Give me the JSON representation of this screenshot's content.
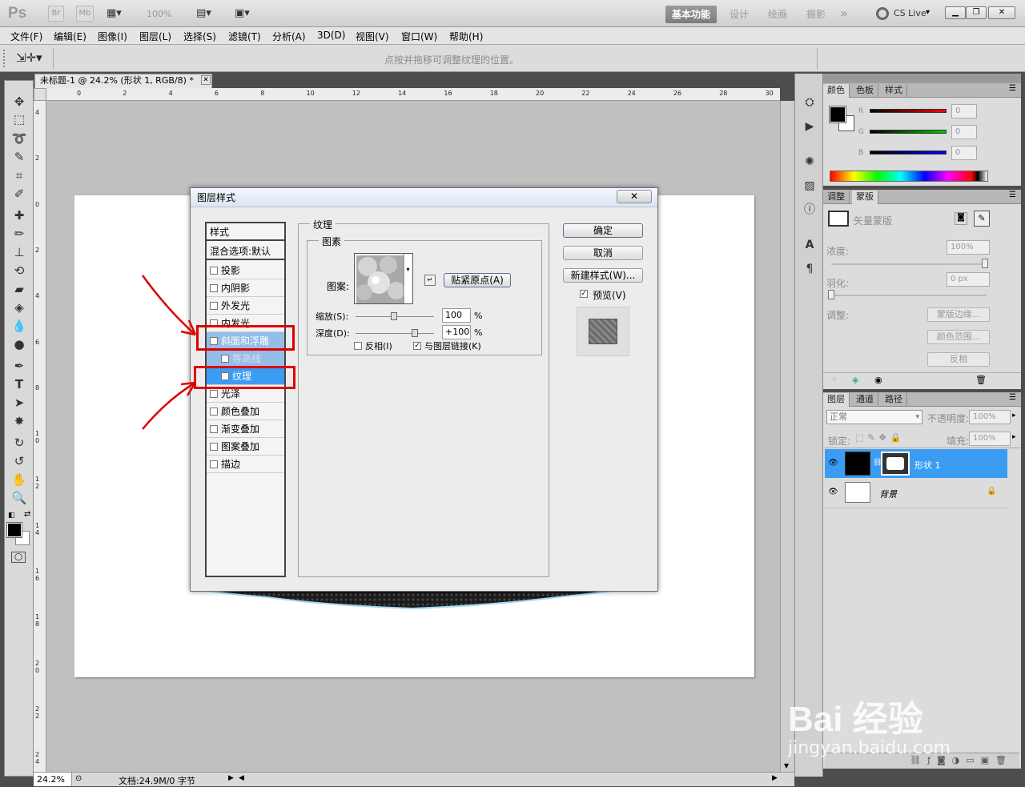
{
  "titlebar": {
    "app_logo": "Ps",
    "br": "Br",
    "mb": "Mb",
    "zoom": "100%",
    "workspaces": [
      "基本功能",
      "设计",
      "绘画",
      "摄影"
    ],
    "more": "»",
    "cslive": "CS Live"
  },
  "menubar": [
    "文件(F)",
    "编辑(E)",
    "图像(I)",
    "图层(L)",
    "选择(S)",
    "滤镜(T)",
    "分析(A)",
    "3D(D)",
    "视图(V)",
    "窗口(W)",
    "帮助(H)"
  ],
  "options": {
    "hint": "点按并拖移可调整纹理的位置。"
  },
  "document": {
    "tab_title": "未标题-1 @ 24.2% (形状 1, RGB/8) *",
    "ruler_h": [
      "0",
      "2",
      "4",
      "6",
      "8",
      "10",
      "12",
      "14",
      "16",
      "18",
      "20",
      "22",
      "24",
      "26",
      "28",
      "30"
    ],
    "ruler_v": [
      "4",
      "2",
      "0",
      "2",
      "4",
      "6",
      "8",
      "1\n0",
      "1\n2",
      "1\n4",
      "1\n6",
      "1\n8",
      "2\n0",
      "2\n2",
      "2\n4"
    ],
    "zoom": "24.2%",
    "doc_info": "文档:24.9M/0 字节"
  },
  "dialog": {
    "title": "图层样式",
    "styles_header": "样式",
    "blend_options": "混合选项:默认",
    "style_items": [
      {
        "label": "投影",
        "checked": false
      },
      {
        "label": "内阴影",
        "checked": false
      },
      {
        "label": "外发光",
        "checked": false
      },
      {
        "label": "内发光",
        "checked": false
      },
      {
        "label": "斜面和浮雕",
        "checked": true
      },
      {
        "label": "等高线",
        "checked": false
      },
      {
        "label": "纹理",
        "checked": true
      },
      {
        "label": "光泽",
        "checked": false
      },
      {
        "label": "颜色叠加",
        "checked": false
      },
      {
        "label": "渐变叠加",
        "checked": false
      },
      {
        "label": "图案叠加",
        "checked": false
      },
      {
        "label": "描边",
        "checked": false
      }
    ],
    "texture_group": "纹理",
    "elements_group": "图素",
    "pattern_label": "图案:",
    "snap_button": "贴紧原点(A)",
    "scale_label": "缩放(S):",
    "scale_value": "100",
    "depth_label": "深度(D):",
    "depth_value": "+100",
    "percent": "%",
    "invert_label": "反相(I)",
    "link_label": "与图层链接(K)",
    "ok": "确定",
    "cancel": "取消",
    "new_style": "新建样式(W)...",
    "preview": "预览(V)"
  },
  "color_panel": {
    "tabs": [
      "颜色",
      "色板",
      "样式"
    ],
    "channels": [
      {
        "name": "R",
        "value": "0"
      },
      {
        "name": "G",
        "value": "0"
      },
      {
        "name": "B",
        "value": "0"
      }
    ]
  },
  "adjust_panel": {
    "tabs": [
      "调整",
      "蒙版"
    ],
    "vector_mask": "矢量蒙版",
    "density_label": "浓度:",
    "density_value": "100%",
    "feather_label": "羽化:",
    "feather_value": "0 px",
    "adjust_label": "调整:",
    "buttons": [
      "蒙版边缘...",
      "颜色范围...",
      "反相"
    ]
  },
  "layers_panel": {
    "tabs": [
      "图层",
      "通道",
      "路径"
    ],
    "blend_mode": "正常",
    "opacity_label": "不透明度:",
    "opacity_value": "100%",
    "lock_label": "锁定:",
    "fill_label": "填充:",
    "fill_value": "100%",
    "layers": [
      {
        "name": "形状 1",
        "selected": true
      },
      {
        "name": "背景",
        "selected": false
      }
    ]
  },
  "watermark": {
    "brand": "Bai 经验",
    "url": "jingyan.baidu.com"
  }
}
